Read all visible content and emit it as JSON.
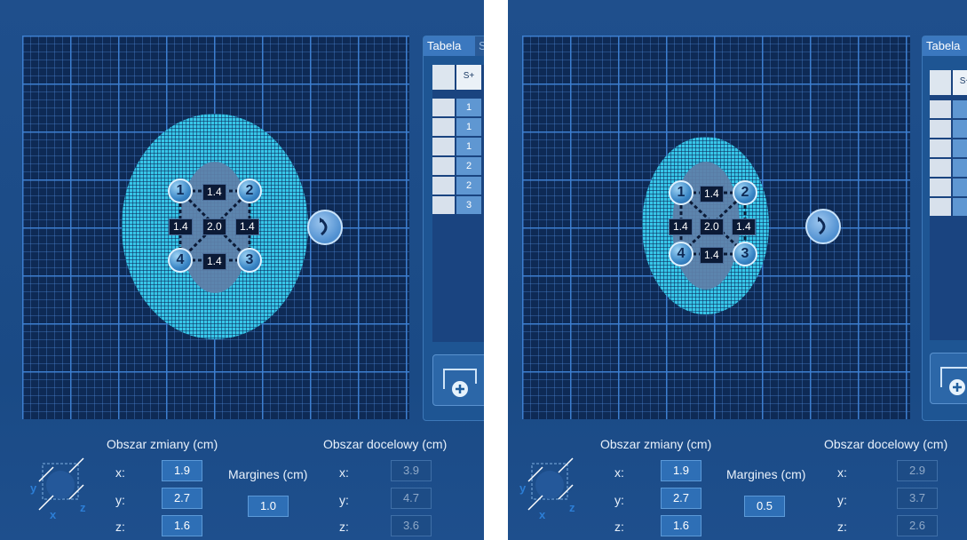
{
  "panels": [
    {
      "tab_label": "Tabela",
      "tab_label_2": "S",
      "table_header": "S+",
      "table_rows": [
        "1",
        "1",
        "1",
        "2",
        "2",
        "3"
      ],
      "probes": [
        "1",
        "2",
        "3",
        "4"
      ],
      "distances": {
        "top": "1.4",
        "left": "1.4",
        "center": "2.0",
        "right": "1.4",
        "bottom": "1.4"
      },
      "zone_title": "Obszar zmiany (cm)",
      "target_title": "Obszar docelowy (cm)",
      "margin_title": "Margines (cm)",
      "axis_labels": [
        "x:",
        "y:",
        "z:"
      ],
      "zone_values": [
        "1.9",
        "2.7",
        "1.6"
      ],
      "margin_value": "1.0",
      "target_values": [
        "3.9",
        "4.7",
        "3.6"
      ],
      "cube_axes": {
        "x": "x",
        "y": "y",
        "z": "z"
      }
    },
    {
      "tab_label": "Tabela",
      "table_header": "S+",
      "table_rows": [
        "",
        "",
        "",
        "",
        "",
        ""
      ],
      "probes": [
        "1",
        "2",
        "3",
        "4"
      ],
      "distances": {
        "top": "1.4",
        "left": "1.4",
        "center": "2.0",
        "right": "1.4",
        "bottom": "1.4"
      },
      "zone_title": "Obszar zmiany (cm)",
      "target_title": "Obszar docelowy (cm)",
      "margin_title": "Margines (cm)",
      "axis_labels": [
        "x:",
        "y:",
        "z:"
      ],
      "zone_values": [
        "1.9",
        "2.7",
        "1.6"
      ],
      "margin_value": "0.5",
      "target_values": [
        "2.9",
        "3.7",
        "2.6"
      ],
      "cube_axes": {
        "x": "x",
        "y": "y",
        "z": "z"
      }
    }
  ],
  "colors": {
    "zone": "#37c6e8",
    "core": "#5f7fa8",
    "background": "#1f4f8c",
    "grid": "#0e2a55"
  },
  "icons": {
    "rotate": "rotate-icon",
    "add": "add-probe-icon",
    "cube": "cube-axes-icon"
  }
}
